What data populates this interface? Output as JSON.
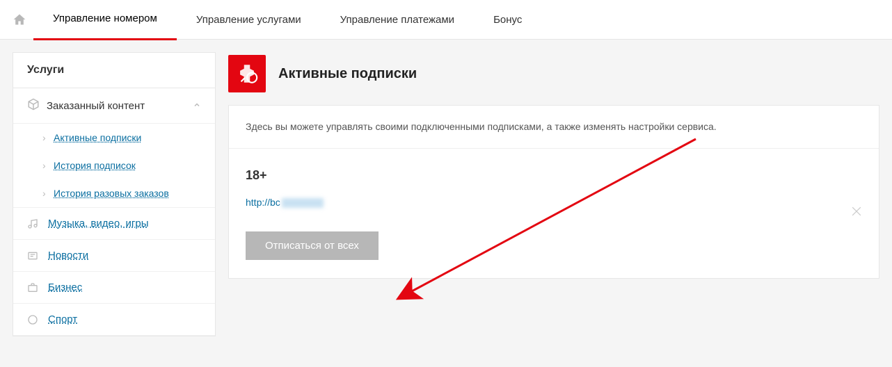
{
  "nav": {
    "tabs": [
      {
        "label": "Управление номером"
      },
      {
        "label": "Управление услугами"
      },
      {
        "label": "Управление платежами"
      },
      {
        "label": "Бонус"
      }
    ]
  },
  "sidebar": {
    "title": "Услуги",
    "section": {
      "label": "Заказанный контент"
    },
    "sub": [
      {
        "label": "Активные подписки"
      },
      {
        "label": "История подписок"
      },
      {
        "label": "История разовых заказов"
      }
    ],
    "links": [
      {
        "label": "Музыка, видео, игры"
      },
      {
        "label": "Новости"
      },
      {
        "label": "Бизнес"
      },
      {
        "label": "Спорт"
      }
    ]
  },
  "main": {
    "title": "Активные подписки",
    "note": "Здесь вы можете управлять своими подключенными подписками, а также изменять настройки сервиса.",
    "item": {
      "title": "18+",
      "link_prefix": "http://bc"
    },
    "unsub_label": "Отписаться от всех"
  }
}
